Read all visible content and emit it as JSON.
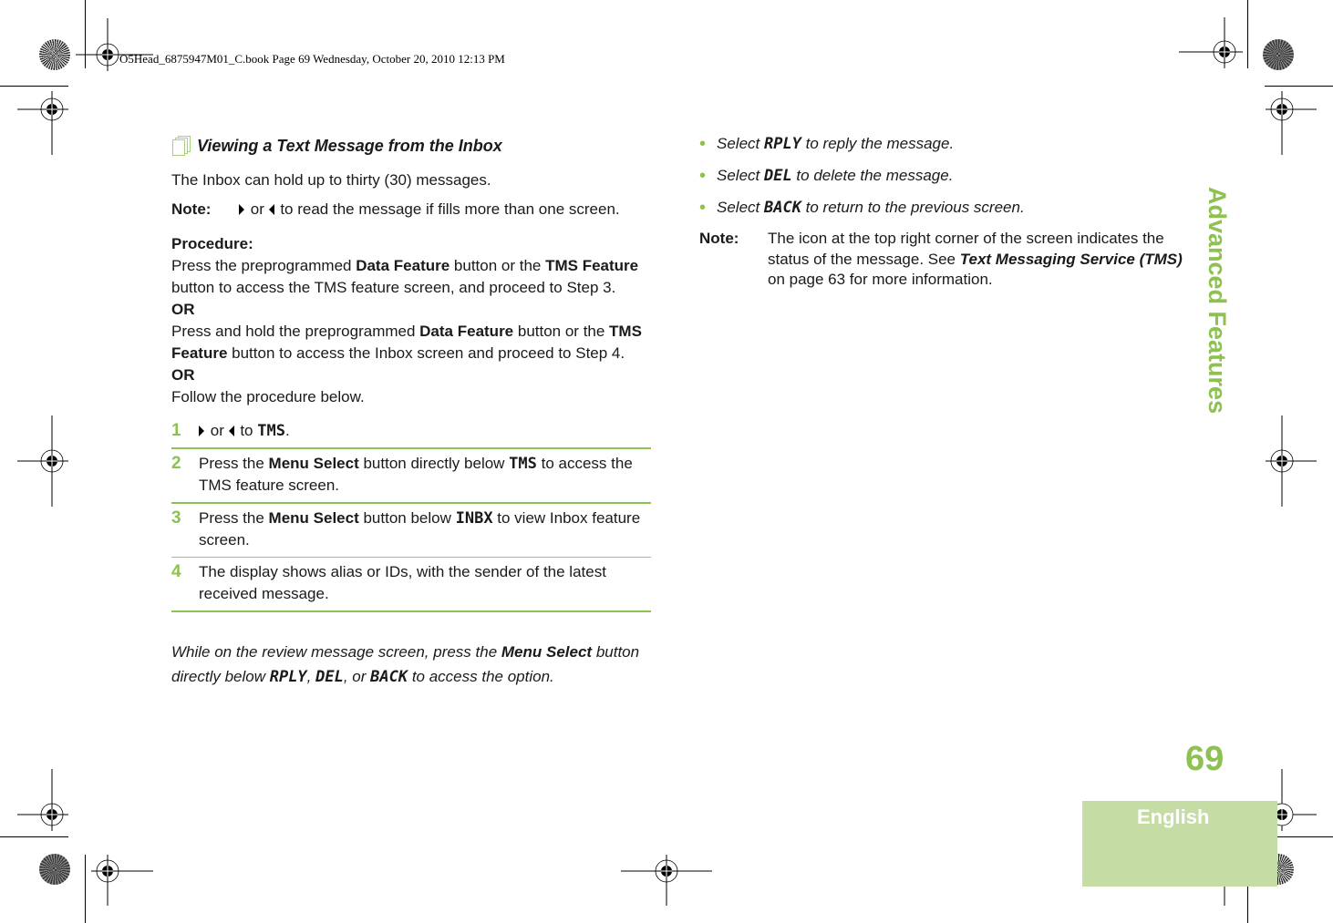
{
  "slug": "O5Head_6875947M01_C.book  Page 69  Wednesday, October 20, 2010  12:13 PM",
  "side_title": "Advanced Features",
  "page_number": "69",
  "language_tab": "English",
  "accent_color": "#8dc150",
  "left": {
    "section_title": "Viewing a Text Message from the Inbox",
    "intro": "The Inbox can hold up to thirty (30) messages.",
    "note": {
      "label": "Note:",
      "or": "or",
      "text": "to read the message if fills more than one screen."
    },
    "procedure": {
      "heading": "Procedure:",
      "p1_a": "Press the preprogrammed ",
      "p1_b": "Data Feature",
      "p1_c": " button or the ",
      "p1_d": "TMS Feature",
      "p1_e": " button to access the TMS feature screen, and proceed to Step 3.",
      "or1": "OR",
      "p2_a": "Press and hold the preprogrammed ",
      "p2_b": "Data Feature",
      "p2_c": " button or the ",
      "p2_d": "TMS Feature",
      "p2_e": " button to access the Inbox screen and proceed to Step 4.",
      "or2": "OR",
      "p3": "Follow the procedure below."
    },
    "steps": [
      {
        "num": "1",
        "or": "or",
        "to": "to",
        "lcd": "TMS",
        "end": "."
      },
      {
        "num": "2",
        "a": "Press the ",
        "b": "Menu Select",
        "c": " button directly below ",
        "lcd": "TMS",
        "d": " to access the TMS feature screen."
      },
      {
        "num": "3",
        "a": "Press the ",
        "b": "Menu Select",
        "c": " button below ",
        "lcd": "INBX",
        "d": " to view Inbox feature screen."
      },
      {
        "num": "4",
        "text": "The display shows alias or IDs, with the sender of the latest received message."
      }
    ],
    "closing": {
      "a": "While on the review message screen, press the ",
      "b": "Menu Select",
      "c": " button directly below ",
      "lcd1": "RPLY",
      "sep1": ", ",
      "lcd2": "DEL",
      "sep2": ", or ",
      "lcd3": "BACK",
      "d": " to access the option."
    }
  },
  "right": {
    "bullets": [
      {
        "a": "Select ",
        "lcd": "RPLY",
        "b": " to reply the message."
      },
      {
        "a": "Select ",
        "lcd": "DEL",
        "b": " to delete the message."
      },
      {
        "a": "Select ",
        "lcd": "BACK",
        "b": " to return to the previous screen."
      }
    ],
    "note": {
      "label": "Note:",
      "a": "The icon at the top right corner of the screen indicates the status of the message. See ",
      "link": "Text Messaging Service (TMS)",
      "b": " on page 63 for more information."
    }
  }
}
